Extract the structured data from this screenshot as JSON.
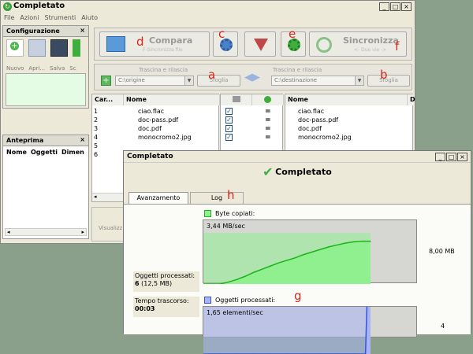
{
  "app": {
    "title": "Completato",
    "menu": [
      "File",
      "Azioni",
      "Strumenti",
      "Aiuto"
    ],
    "minimize": "_",
    "maximize": "□",
    "close": "×"
  },
  "config_panel": {
    "title": "Configurazione",
    "close": "×",
    "tools": [
      "Nuovo",
      "Apri...",
      "Salva",
      "Sc"
    ]
  },
  "preview_panel": {
    "title": "Anteprima",
    "close": "×",
    "columns": [
      "Nome",
      "Oggetti",
      "Dimen"
    ]
  },
  "toolbar": {
    "compare_label": "Compara",
    "compare_sub": "F-Sincronizza file",
    "sync_label": "Sincronizza",
    "sync_sub": "<- Due vie ->"
  },
  "folders": {
    "left_hint": "Trascina e rilascia",
    "left_path": "C:\\origine",
    "left_browse": "Sfoglia",
    "right_hint": "Trascina e rilascia",
    "right_path": "C:\\destinazione",
    "right_browse": "Sfoglia"
  },
  "grid": {
    "left_headers": [
      "Car...",
      "Nome"
    ],
    "right_headers": [
      "Nome",
      "D"
    ],
    "row_numbers": [
      "1",
      "2",
      "3",
      "4",
      "5",
      "6"
    ],
    "files": [
      "ciao.flac",
      "doc-pass.pdf",
      "doc.pdf",
      "monocromo2.jpg"
    ],
    "check": "✓",
    "equal": "="
  },
  "status": {
    "left_label": "Visualizz"
  },
  "annotations": [
    "a",
    "b",
    "c",
    "d",
    "e",
    "f",
    "g",
    "h"
  ],
  "dialog": {
    "title": "Completato",
    "heading": "Completato",
    "tabs": [
      "Avanzamento",
      "Log"
    ],
    "bytes_legend": "Byte copiati:",
    "bytes_rate": "3,44 MB/sec",
    "bytes_max": "8,00 MB",
    "items_legend": "Oggetti processati:",
    "items_rate": "1,65 elementi/sec",
    "items_max": "4",
    "processed_label": "Oggetti processati:",
    "processed_value": "6",
    "processed_size": "(12,5 MB)",
    "elapsed_label": "Tempo trascorso:",
    "elapsed_value": "00:03"
  },
  "colors": {
    "bytes_fill": "#90f090",
    "bytes_line": "#18b418",
    "items_fill": "#aab4f4",
    "items_line": "#3355dd",
    "check_green": "#3fae3f",
    "label_red": "#d9261c"
  },
  "chart_data": [
    {
      "type": "area",
      "title": "Byte copiati:",
      "ylabel": "8,00 MB",
      "ylim": [
        0,
        8
      ],
      "x": [
        0,
        0.05,
        0.1,
        0.15,
        0.2,
        0.25,
        0.3,
        0.35,
        0.4,
        0.45,
        0.5,
        0.55,
        0.6,
        0.65,
        0.7,
        0.75,
        0.8,
        0.85,
        0.9,
        0.95,
        1.0
      ],
      "values": [
        0,
        0,
        0,
        0.3,
        0.7,
        1.2,
        1.8,
        2.3,
        2.8,
        3.3,
        3.7,
        4.1,
        4.6,
        5.0,
        5.4,
        5.8,
        6.1,
        6.4,
        6.6,
        6.7,
        6.7
      ]
    },
    {
      "type": "area",
      "title": "Oggetti processati:",
      "ylabel": "4",
      "ylim": [
        0,
        4
      ],
      "x": [
        0,
        0.1,
        0.2,
        0.3,
        0.4,
        0.5,
        0.6,
        0.7,
        0.8,
        0.9,
        0.97,
        0.98,
        1.0
      ],
      "values": [
        0,
        0,
        0,
        0,
        0,
        0,
        0,
        0,
        0,
        0,
        0,
        4.8,
        4.8
      ]
    }
  ]
}
